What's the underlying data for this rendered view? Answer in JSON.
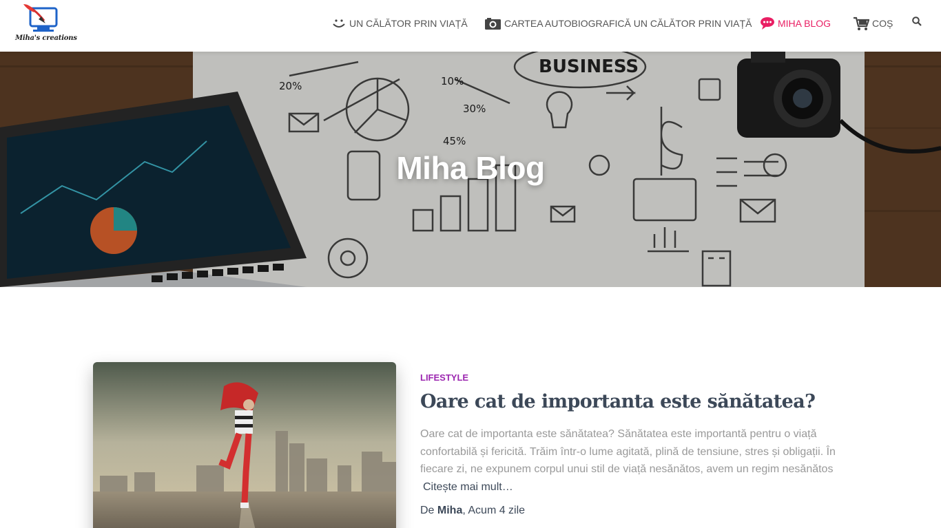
{
  "site": {
    "logo_text": "Miha's creations"
  },
  "nav": {
    "items": [
      {
        "label": "UN CĂLĂTOR PRIN VIAȚĂ",
        "icon": "smile-icon"
      },
      {
        "label": "CARTEA AUTOBIOGRAFICĂ UN CĂLĂTOR PRIN VIAȚĂ",
        "icon": "camera-icon"
      },
      {
        "label": "MIHA BLOG",
        "icon": "chat-bubble-icon",
        "active": true
      },
      {
        "label": "COȘ",
        "icon": "cart-icon"
      }
    ],
    "search_icon": "search-icon"
  },
  "hero": {
    "title": "Miha Blog"
  },
  "post": {
    "category": "LIFESTYLE",
    "title": "Oare cat de importanta este sănătatea?",
    "excerpt": "Oare cat de importanta este sănătatea? Sănătatea este importantă pentru o viață confortabilă și fericită. Trăim într-o lume agitată, plină de tensiune, stres și obligații. În fiecare zi, ne expunem corpul unui stil de viață nesănătos, avem un regim nesănătos",
    "read_more": "Citește mai mult…",
    "byline_prefix": "De",
    "author": "Miha",
    "time": ", Acum 4 zile"
  },
  "colors": {
    "accent": "#e91e63",
    "category": "#9c27b0",
    "text": "#3c4858",
    "muted": "#999999"
  }
}
